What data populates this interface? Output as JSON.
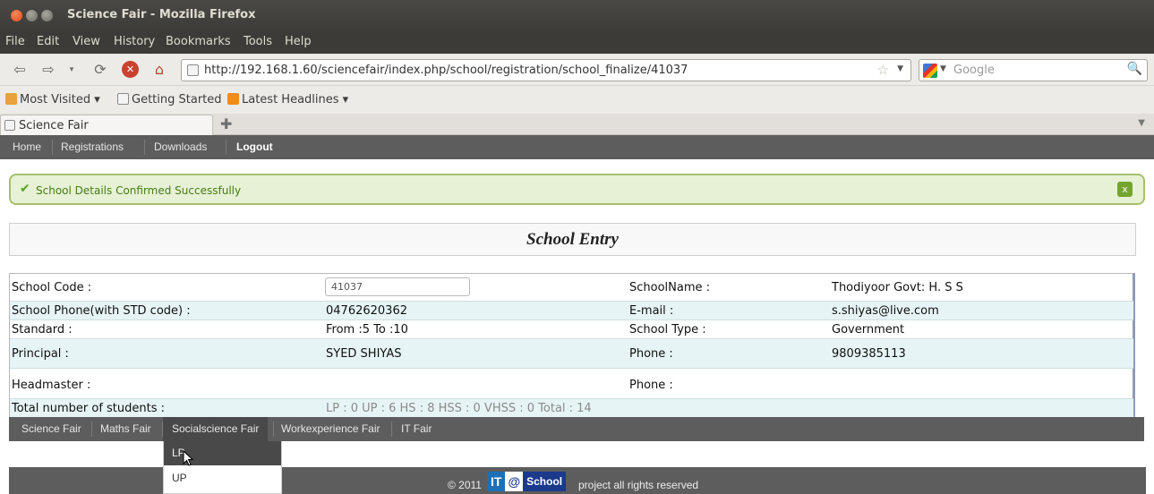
{
  "window": {
    "title": "Science Fair - Mozilla Firefox"
  },
  "menubar": [
    "File",
    "Edit",
    "View",
    "History",
    "Bookmarks",
    "Tools",
    "Help"
  ],
  "toolbar": {
    "url": "http://192.168.1.60/sciencefair/index.php/school/registration/school_finalize/41037",
    "search_placeholder": "Google"
  },
  "bookmarks": {
    "most_visited": "Most Visited ▾",
    "getting_started": "Getting Started",
    "latest_headlines": "Latest Headlines ▾"
  },
  "tab": {
    "label": "Science Fair"
  },
  "nav": {
    "home": "Home",
    "registrations": "Registrations",
    "downloads": "Downloads",
    "logout": "Logout"
  },
  "message": {
    "text": "School Details Confirmed Successfully",
    "close": "x"
  },
  "page_title": "School Entry",
  "details": {
    "school_code_label": "School Code :",
    "school_code_value": "41037",
    "school_name_label": "SchoolName :",
    "school_name_value": "Thodiyoor Govt: H. S S",
    "phone_label": "School Phone(with STD code) :",
    "phone_value": "04762620362",
    "email_label": "E-mail :",
    "email_value": "s.shiyas@live.com",
    "standard_label": "Standard :",
    "standard_value": "From :5  To :10",
    "school_type_label": "School Type :",
    "school_type_value": "Government",
    "principal_label": "Principal :",
    "principal_value": "SYED SHIYAS",
    "principal_phone_label": "Phone :",
    "principal_phone_value": "9809385113",
    "headmaster_label": "Headmaster :",
    "headmaster_value": "",
    "headmaster_phone_label": "Phone :",
    "headmaster_phone_value": "",
    "students_label": "Total number of students :",
    "students_value": "LP :  0 UP :  6 HS :  8 HSS : 0  VHSS :  0 Total : 14"
  },
  "fair_tabs": [
    "Science Fair",
    "Maths Fair",
    "Socialscience Fair",
    "Workexperience Fair",
    "IT Fair"
  ],
  "dropdown": [
    "LP",
    "UP"
  ],
  "footer": {
    "copyright": "© 2011",
    "logo_it": "IT",
    "logo_at": "@",
    "logo_school": "School",
    "text": "project all rights reserved"
  }
}
